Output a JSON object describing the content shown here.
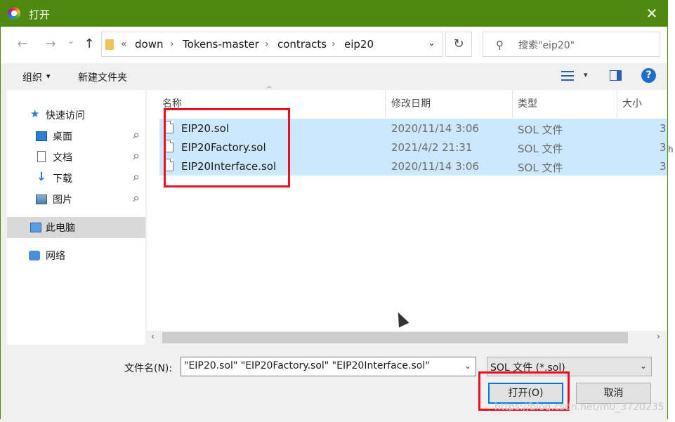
{
  "window": {
    "title": "打开",
    "close_icon": "✕"
  },
  "nav": {
    "back_icon": "←",
    "forward_icon": "→",
    "recent_icon": "⌄",
    "up_icon": "↑",
    "breadcrumb": {
      "overflow": "«",
      "items": [
        "down",
        "Tokens-master",
        "contracts",
        "eip20"
      ],
      "separator": "›",
      "dropdown": "⌄"
    },
    "refresh_icon": "↻",
    "search_placeholder": "搜索\"eip20\"",
    "search_icon": "⚲"
  },
  "toolbar": {
    "organize_label": "组织",
    "organize_caret": "▾",
    "new_folder_label": "新建文件夹",
    "view_caret": "▾",
    "help_label": "?"
  },
  "sidebar": {
    "items": [
      {
        "label": "快速访问",
        "icon": "star-icon"
      },
      {
        "label": "桌面",
        "icon": "desktop-icon",
        "pinned": true
      },
      {
        "label": "文档",
        "icon": "document-icon",
        "pinned": true
      },
      {
        "label": "下载",
        "icon": "download-icon",
        "pinned": true
      },
      {
        "label": "图片",
        "icon": "picture-icon",
        "pinned": true
      },
      {
        "label": "此电脑",
        "icon": "computer-icon",
        "selected": true
      },
      {
        "label": "网络",
        "icon": "network-icon"
      }
    ],
    "pin_glyph": "📌"
  },
  "filelist": {
    "columns": {
      "name": "名称",
      "date": "修改日期",
      "type": "类型",
      "size": "大小"
    },
    "sort_glyph": "^",
    "rows": [
      {
        "name": "EIP20.sol",
        "date": "2020/11/14 3:06",
        "type": "SOL 文件",
        "size": "3"
      },
      {
        "name": "EIP20Factory.sol",
        "date": "2021/4/2 21:31",
        "type": "SOL 文件",
        "size": "3"
      },
      {
        "name": "EIP20Interface.sol",
        "date": "2020/11/14 3:06",
        "type": "SOL 文件",
        "size": "3"
      }
    ]
  },
  "hscroll": {
    "left_arrow": "‹",
    "right_arrow": "›"
  },
  "bottom": {
    "filename_label": "文件名(N):",
    "filename_value": "\"EIP20.sol\" \"EIP20Factory.sol\" \"EIP20Interface.sol\"",
    "filter_value": "SOL 文件 (*.sol)",
    "dropdown_arrow": "⌄",
    "open_label": "打开(O)",
    "cancel_label": "取消"
  },
  "edge": {
    "partial_text": "h"
  },
  "watermark": "https://blog.csdn.net/m0_3720235",
  "colors": {
    "titlebar": "#4f8a10",
    "selection": "#cce8ff",
    "highlight_box": "#e8101c",
    "accent": "#0078d7"
  }
}
